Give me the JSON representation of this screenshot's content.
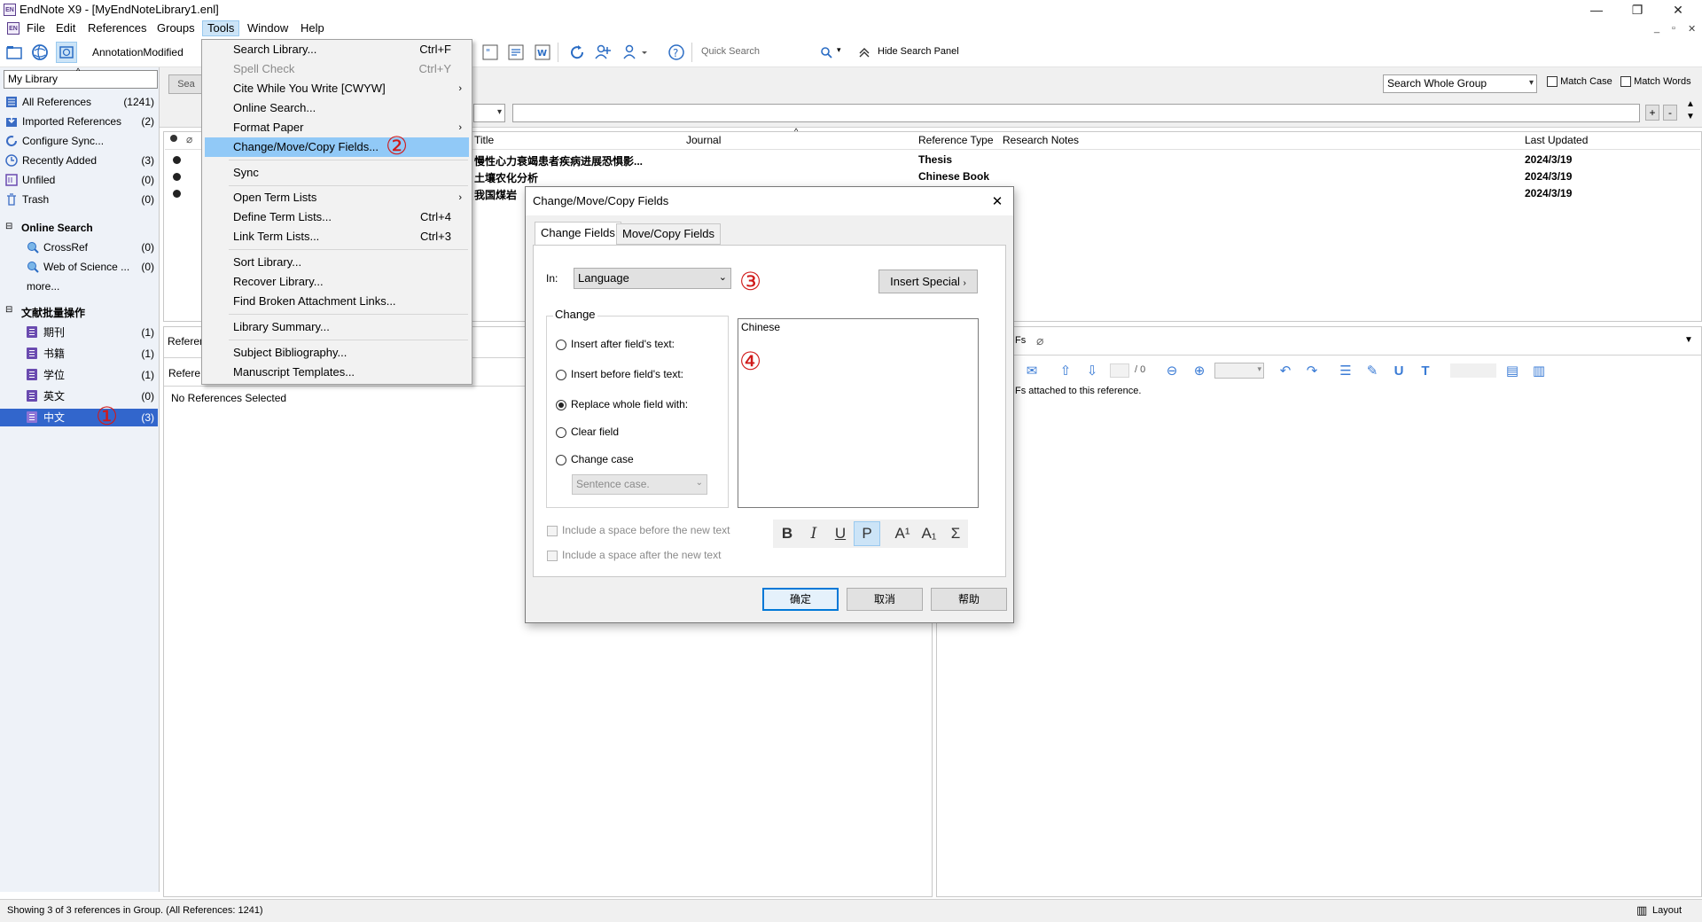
{
  "window": {
    "title": "EndNote X9 - [MyEndNoteLibrary1.enl]",
    "app_icon_text": "EN",
    "minimize": "—",
    "restore": "❐",
    "close": "✕"
  },
  "menubar": {
    "items": [
      "File",
      "Edit",
      "References",
      "Groups",
      "Tools",
      "Window",
      "Help"
    ],
    "active": "Tools"
  },
  "toolbar": {
    "style_name": "AnnotationModified",
    "quick_search_placeholder": "Quick Search",
    "hide_search_panel": "Hide Search Panel"
  },
  "search_panel": {
    "scope": "Search Whole Group",
    "match_case": "Match Case",
    "match_words": "Match Words",
    "search_button": "Sea"
  },
  "left_pane": {
    "library_label": "My Library",
    "items": [
      {
        "label": "All References",
        "count": "(1241)"
      },
      {
        "label": "Imported References",
        "count": "(2)"
      },
      {
        "label": "Configure Sync...",
        "count": ""
      },
      {
        "label": "Recently Added",
        "count": "(3)"
      },
      {
        "label": "Unfiled",
        "count": "(0)"
      },
      {
        "label": "Trash",
        "count": "(0)"
      }
    ],
    "online_search_header": "Online Search",
    "online_items": [
      {
        "label": "CrossRef",
        "count": "(0)"
      },
      {
        "label": "Web of Science ...",
        "count": "(0)"
      }
    ],
    "more": "more...",
    "group_set_header": "文献批量操作",
    "groups": [
      {
        "label": "期刊",
        "count": "(1)"
      },
      {
        "label": "书籍",
        "count": "(1)"
      },
      {
        "label": "学位",
        "count": "(1)"
      },
      {
        "label": "英文",
        "count": "(0)"
      },
      {
        "label": "中文",
        "count": "(3)"
      }
    ]
  },
  "reference_list": {
    "columns": [
      "Title",
      "Journal",
      "Reference Type",
      "Research Notes",
      "Last Updated"
    ],
    "rows": [
      {
        "title": "慢性心力衰竭患者疾病进展恐惧影...",
        "type": "Thesis",
        "updated": "2024/3/19"
      },
      {
        "title": "土壤农化分析",
        "type": "Chinese Book",
        "updated": "2024/3/19"
      },
      {
        "title": "我国煤岩",
        "type": "",
        "updated": "2024/3/19"
      }
    ]
  },
  "bottom": {
    "tab_reference": "Referen",
    "tab_reference2": "Refere",
    "no_refs": "No References Selected",
    "pdf_tab": "Fs",
    "pdf_page": "/ 0",
    "pdf_message": "Fs attached to this reference."
  },
  "statusbar": {
    "text": "Showing 3 of 3 references in Group. (All References: 1241)",
    "layout": "Layout"
  },
  "tools_menu": {
    "items": [
      {
        "label": "Search Library...",
        "shortcut": "Ctrl+F",
        "submenu": false,
        "disabled": false,
        "highlighted": false
      },
      {
        "label": "Spell Check",
        "shortcut": "Ctrl+Y",
        "submenu": false,
        "disabled": true,
        "highlighted": false
      },
      {
        "label": "Cite While You Write [CWYW]",
        "shortcut": "",
        "submenu": true,
        "disabled": false,
        "highlighted": false
      },
      {
        "label": "Online Search...",
        "shortcut": "",
        "submenu": false,
        "disabled": false,
        "highlighted": false
      },
      {
        "label": "Format Paper",
        "shortcut": "",
        "submenu": true,
        "disabled": false,
        "highlighted": false
      },
      {
        "label": "Change/Move/Copy Fields...",
        "shortcut": "",
        "submenu": false,
        "disabled": false,
        "highlighted": true
      },
      {
        "label": "Sync",
        "shortcut": "",
        "submenu": false,
        "disabled": false,
        "highlighted": false
      },
      {
        "label": "Open Term Lists",
        "shortcut": "",
        "submenu": true,
        "disabled": false,
        "highlighted": false
      },
      {
        "label": "Define Term Lists...",
        "shortcut": "Ctrl+4",
        "submenu": false,
        "disabled": false,
        "highlighted": false
      },
      {
        "label": "Link Term Lists...",
        "shortcut": "Ctrl+3",
        "submenu": false,
        "disabled": false,
        "highlighted": false
      },
      {
        "label": "Sort Library...",
        "shortcut": "",
        "submenu": false,
        "disabled": false,
        "highlighted": false
      },
      {
        "label": "Recover Library...",
        "shortcut": "",
        "submenu": false,
        "disabled": false,
        "highlighted": false
      },
      {
        "label": "Find Broken Attachment Links...",
        "shortcut": "",
        "submenu": false,
        "disabled": false,
        "highlighted": false
      },
      {
        "label": "Library Summary...",
        "shortcut": "",
        "submenu": false,
        "disabled": false,
        "highlighted": false
      },
      {
        "label": "Subject Bibliography...",
        "shortcut": "",
        "submenu": false,
        "disabled": false,
        "highlighted": false
      },
      {
        "label": "Manuscript Templates...",
        "shortcut": "",
        "submenu": false,
        "disabled": false,
        "highlighted": false
      }
    ]
  },
  "dialog": {
    "title": "Change/Move/Copy Fields",
    "tabs": [
      "Change Fields",
      "Move/Copy Fields"
    ],
    "in_label": "In:",
    "field": "Language",
    "insert_special": "Insert Special",
    "change_group": "Change",
    "options": [
      {
        "label": "Insert after field's text:",
        "selected": false
      },
      {
        "label": "Insert before field's text:",
        "selected": false
      },
      {
        "label": "Replace whole field with:",
        "selected": true
      },
      {
        "label": "Clear field",
        "selected": false
      },
      {
        "label": "Change case",
        "selected": false
      }
    ],
    "case_option": "Sentence case.",
    "text_value": "Chinese",
    "space_before": "Include a space before the new text",
    "space_after": "Include a space after the new text",
    "format_buttons": [
      "B",
      "I",
      "U",
      "P",
      "A¹",
      "A₁",
      "Σ"
    ],
    "ok": "确定",
    "cancel": "取消",
    "help": "帮助"
  },
  "annotations": {
    "one": "①",
    "two": "②",
    "three": "③",
    "four": "④",
    "color": "#d01a1a"
  },
  "colors": {
    "selection": "#3266cc",
    "menu_highlight": "#91c9f7",
    "accent": "#0078d7"
  }
}
